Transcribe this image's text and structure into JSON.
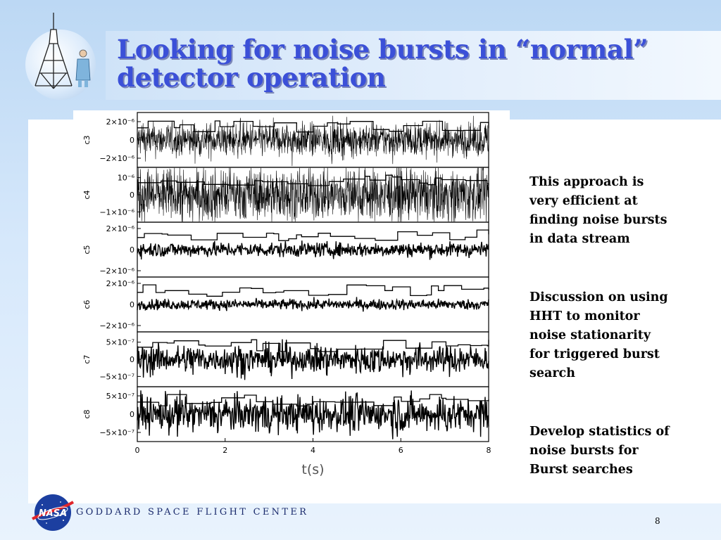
{
  "slide": {
    "title_line1": "Looking for noise bursts in “normal”",
    "title_line2": "detector operation",
    "bullets": [
      [
        "This approach is",
        "very efficient at",
        "finding noise bursts",
        "in data stream"
      ],
      [
        "Discussion on using",
        "HHT to monitor",
        "noise stationarity",
        "for triggered burst",
        "search"
      ],
      [
        "Develop statistics of",
        "noise bursts for",
        "Burst searches"
      ]
    ],
    "footer_text": "GODDARD SPACE FLIGHT CENTER",
    "page_number": "8",
    "logo_text": "NASA"
  },
  "chart_data": {
    "type": "line",
    "xlabel": "t(s)",
    "xlim": [
      0,
      8
    ],
    "xticks": [
      0,
      2,
      4,
      6,
      8
    ],
    "xtick_labels": [
      "0",
      "2",
      "4",
      "6",
      "8"
    ],
    "panels": [
      {
        "ylabel": "c3",
        "yticks": [
          {
            "label": "2×10⁻⁶",
            "value": 2e-06
          },
          {
            "label": "0",
            "value": 0
          },
          {
            "label": "−2×10⁻⁶",
            "value": -2e-06
          }
        ],
        "ylim": [
          -3e-06,
          3e-06
        ],
        "noise_amp": 9e-07,
        "style": "dense"
      },
      {
        "ylabel": "c4",
        "yticks": [
          {
            "label": "10⁻⁶",
            "value": 1e-06
          },
          {
            "label": "0",
            "value": 0
          },
          {
            "label": "−1×10⁻⁶",
            "value": -1e-06
          }
        ],
        "ylim": [
          -1.6e-06,
          1.6e-06
        ],
        "noise_amp": 7.5e-07,
        "style": "dense"
      },
      {
        "ylabel": "c5",
        "yticks": [
          {
            "label": "2×10⁻⁶",
            "value": 2e-06
          },
          {
            "label": "0",
            "value": 0
          },
          {
            "label": "−2×10⁻⁶",
            "value": -2e-06
          }
        ],
        "ylim": [
          -2.6e-06,
          2.6e-06
        ],
        "noise_amp": 3.5e-07,
        "style": "line"
      },
      {
        "ylabel": "c6",
        "yticks": [
          {
            "label": "2×10⁻⁶",
            "value": 2e-06
          },
          {
            "label": "0",
            "value": 0
          },
          {
            "label": "−2×10⁻⁶",
            "value": -2e-06
          }
        ],
        "ylim": [
          -2.6e-06,
          2.6e-06
        ],
        "noise_amp": 2.5e-07,
        "style": "line"
      },
      {
        "ylabel": "c7",
        "yticks": [
          {
            "label": "5×10⁻⁷",
            "value": 5e-07
          },
          {
            "label": "0",
            "value": 0
          },
          {
            "label": "−5×10⁻⁷",
            "value": -5e-07
          }
        ],
        "ylim": [
          -8e-07,
          8e-07
        ],
        "noise_amp": 1.5e-07,
        "style": "line"
      },
      {
        "ylabel": "c8",
        "yticks": [
          {
            "label": "5×10⁻⁷",
            "value": 5e-07
          },
          {
            "label": "0",
            "value": 0
          },
          {
            "label": "−5×10⁻⁷",
            "value": -5e-07
          }
        ],
        "ylim": [
          -7.5e-07,
          7.5e-07
        ],
        "noise_amp": 1.8e-07,
        "style": "line"
      }
    ]
  }
}
